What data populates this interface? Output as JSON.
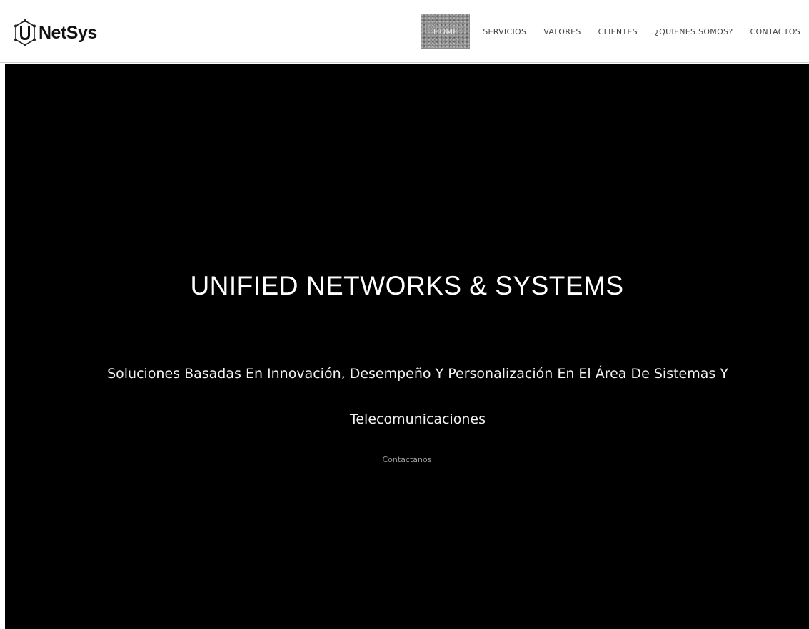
{
  "brand": {
    "name": "NetSys",
    "logo_icon": "u-hexagon-logo-icon"
  },
  "nav": {
    "items": [
      {
        "label": "HOME",
        "active": true
      },
      {
        "label": "SERVICIOS",
        "active": false
      },
      {
        "label": "VALORES",
        "active": false
      },
      {
        "label": "CLIENTES",
        "active": false
      },
      {
        "label": "¿QUIENES SOMOS?",
        "active": false
      },
      {
        "label": "CONTACTOS",
        "active": false
      }
    ]
  },
  "hero": {
    "title": "UNIFIED NETWORKS & SYSTEMS",
    "subtitle": "Soluciones Basadas En Innovación, Desempeño Y Personalización En El Área De Sistemas Y Telecomunicaciones",
    "cta_label": "Contactanos"
  },
  "colors": {
    "hero_background": "#000000",
    "navbar_background": "#ffffff",
    "active_nav_background": "#8a8a8a"
  }
}
